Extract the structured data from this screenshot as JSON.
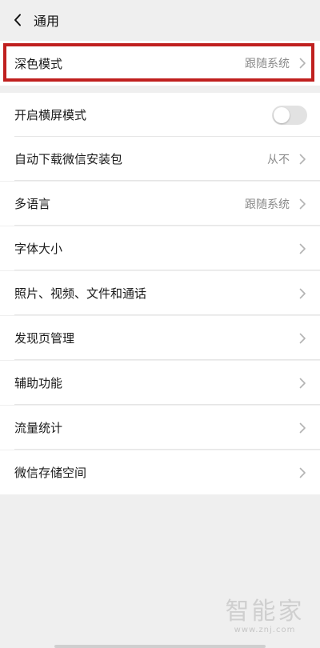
{
  "header": {
    "title": "通用"
  },
  "dark_mode": {
    "label": "深色模式",
    "value": "跟随系统"
  },
  "items": [
    {
      "label": "开启横屏模式",
      "type": "toggle",
      "toggle_on": false
    },
    {
      "label": "自动下载微信安装包",
      "value": "从不"
    },
    {
      "label": "多语言",
      "value": "跟随系统"
    },
    {
      "label": "字体大小",
      "value": ""
    },
    {
      "label": "照片、视频、文件和通话",
      "value": ""
    },
    {
      "label": "发现页管理",
      "value": ""
    },
    {
      "label": "辅助功能",
      "value": ""
    },
    {
      "label": "流量统计",
      "value": ""
    },
    {
      "label": "微信存储空间",
      "value": ""
    }
  ],
  "watermark": {
    "text": "智能家",
    "url": "www.znj.com"
  },
  "colors": {
    "highlight": "#c0201f",
    "background": "#efefef",
    "row": "#ffffff"
  }
}
